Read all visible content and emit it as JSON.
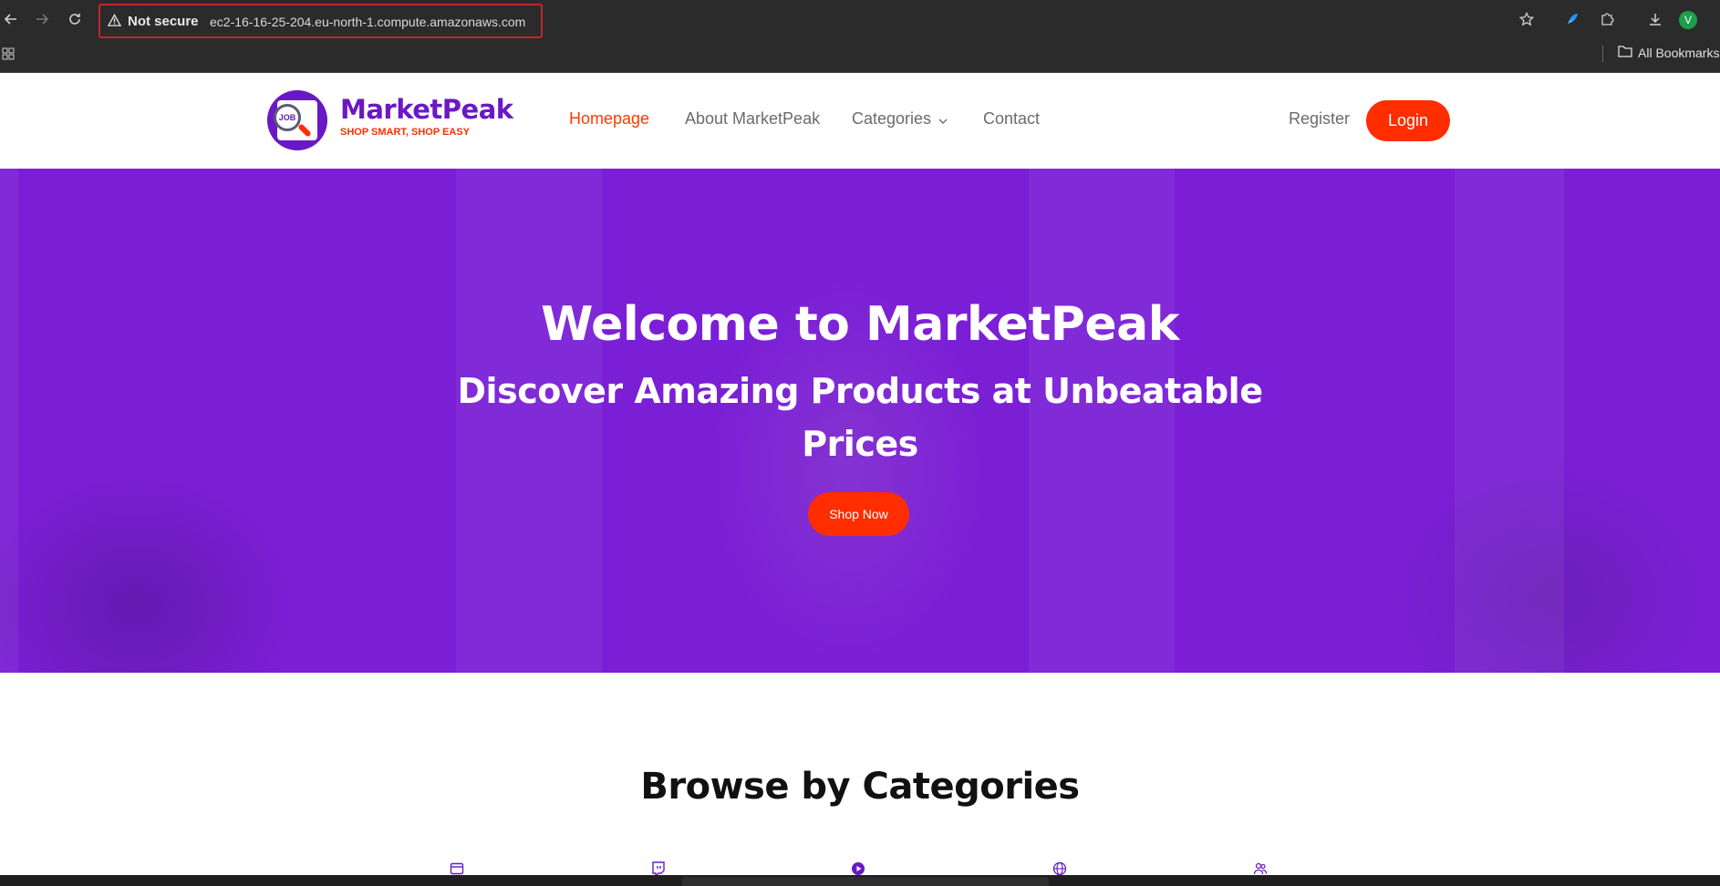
{
  "browser": {
    "security_label": "Not secure",
    "url": "ec2-16-16-25-204.eu-north-1.compute.amazonaws.com",
    "bookmarks_label": "All Bookmarks",
    "profile_initial": "V",
    "icons": [
      "back-icon",
      "forward-icon",
      "reload-icon",
      "warning-icon",
      "star-icon",
      "extension-icon",
      "puzzle-icon",
      "download-icon",
      "apps-icon",
      "folder-icon"
    ]
  },
  "header": {
    "brand_name": "MarketPeak",
    "brand_tagline": "SHOP SMART, SHOP EASY",
    "logo_text": "JOB",
    "nav": [
      {
        "label": "Homepage",
        "active": true
      },
      {
        "label": "About MarketPeak",
        "active": false
      },
      {
        "label": "Categories",
        "active": false
      },
      {
        "label": "Contact",
        "active": false
      }
    ],
    "register_label": "Register",
    "login_label": "Login"
  },
  "hero": {
    "title": "Welcome to MarketPeak",
    "subtitle": "Discover Amazing Products at Unbeatable Prices",
    "cta_label": "Shop Now"
  },
  "categories": {
    "title": "Browse by Categories",
    "icons": [
      "browser-icon",
      "twitch-icon",
      "play-icon",
      "globe-icon",
      "users-icon"
    ]
  },
  "colors": {
    "brand_purple": "#6a18c6",
    "hero_purple": "#7b1fd6",
    "accent_red": "#ff2d00",
    "chrome_dark": "#2b2b2b"
  }
}
